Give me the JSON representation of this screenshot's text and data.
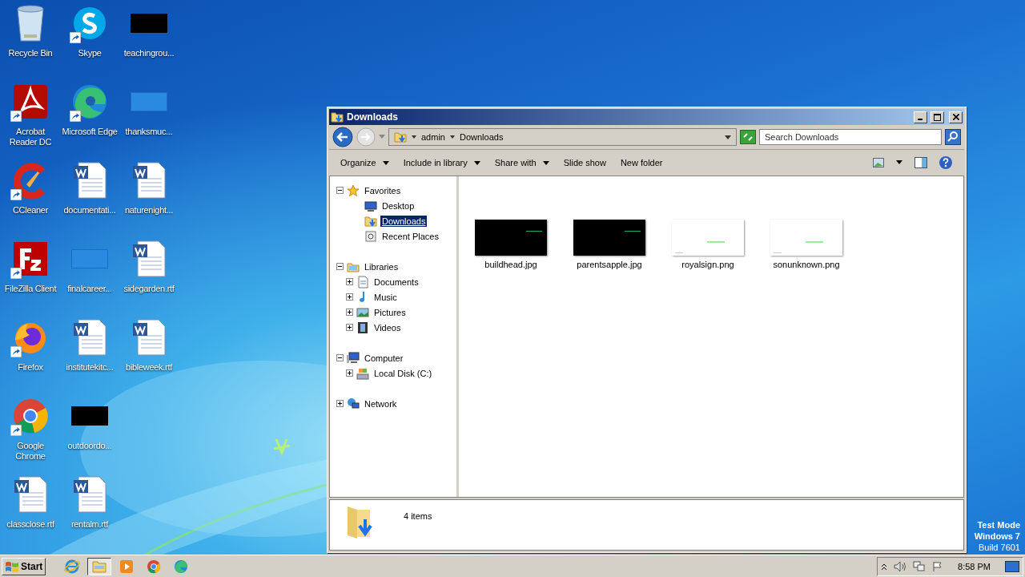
{
  "desktop_icons": [
    {
      "label": "Recycle Bin",
      "kind": "bin",
      "shortcut": false
    },
    {
      "label": "Acrobat Reader DC",
      "kind": "app",
      "shortcut": true
    },
    {
      "label": "CCleaner",
      "kind": "app",
      "shortcut": true
    },
    {
      "label": "FileZilla Client",
      "kind": "app",
      "shortcut": true
    },
    {
      "label": "Firefox",
      "kind": "app",
      "shortcut": true
    },
    {
      "label": "Google Chrome",
      "kind": "app",
      "shortcut": true
    },
    {
      "label": "classclose.rtf",
      "kind": "doc",
      "shortcut": false
    },
    {
      "label": "Skype",
      "kind": "app",
      "shortcut": true
    },
    {
      "label": "Microsoft Edge",
      "kind": "app",
      "shortcut": true
    },
    {
      "label": "documentati...",
      "kind": "doc",
      "shortcut": false
    },
    {
      "label": "finalcareer...",
      "kind": "blank",
      "shortcut": false
    },
    {
      "label": "institutekitc...",
      "kind": "doc",
      "shortcut": false
    },
    {
      "label": "outdoordo...",
      "kind": "dark",
      "shortcut": false
    },
    {
      "label": "rentalm.rtf",
      "kind": "doc",
      "shortcut": false
    },
    {
      "label": "teachingrou...",
      "kind": "dark",
      "shortcut": false
    },
    {
      "label": "thanksmuc...",
      "kind": "blank",
      "shortcut": false
    },
    {
      "label": "naturenight...",
      "kind": "doc",
      "shortcut": false
    },
    {
      "label": "sidegarden.rtf",
      "kind": "doc",
      "shortcut": false
    },
    {
      "label": "bibleweek.rtf",
      "kind": "doc",
      "shortcut": false
    }
  ],
  "window": {
    "title": "Downloads",
    "address": {
      "crumbs": [
        "admin",
        "Downloads"
      ]
    },
    "search": {
      "placeholder": "Search Downloads"
    },
    "toolbar": [
      {
        "label": "Organize",
        "dropdown": true
      },
      {
        "label": "Include in library",
        "dropdown": true
      },
      {
        "label": "Share with",
        "dropdown": true
      },
      {
        "label": "Slide show",
        "dropdown": false
      },
      {
        "label": "New folder",
        "dropdown": false
      }
    ],
    "nav_tree": [
      {
        "label": "Favorites",
        "kind": "star",
        "expanded": true,
        "selected": false,
        "children": [
          {
            "label": "Desktop",
            "kind": "desktop",
            "selected": false
          },
          {
            "label": "Downloads",
            "kind": "downloads",
            "selected": true
          },
          {
            "label": "Recent Places",
            "kind": "recent",
            "selected": false
          }
        ]
      },
      {
        "label": "Libraries",
        "kind": "library",
        "expanded": true,
        "selected": false,
        "children": [
          {
            "label": "Documents",
            "kind": "documents",
            "expanded": false,
            "selected": false
          },
          {
            "label": "Music",
            "kind": "music",
            "expanded": false,
            "selected": false
          },
          {
            "label": "Pictures",
            "kind": "pictures",
            "expanded": false,
            "selected": false
          },
          {
            "label": "Videos",
            "kind": "videos",
            "expanded": false,
            "selected": false
          }
        ]
      },
      {
        "label": "Computer",
        "kind": "computer",
        "expanded": true,
        "selected": false,
        "children": [
          {
            "label": "Local Disk (C:)",
            "kind": "disk",
            "expanded": false,
            "selected": false
          }
        ]
      },
      {
        "label": "Network",
        "kind": "network",
        "expanded": false,
        "selected": false
      }
    ],
    "files": [
      {
        "name": "buildhead.jpg",
        "kind": "dark"
      },
      {
        "name": "parentsapple.jpg",
        "kind": "dark"
      },
      {
        "name": "royalsign.png",
        "kind": "light"
      },
      {
        "name": "sonunknown.png",
        "kind": "light"
      }
    ],
    "status": "4 items"
  },
  "test_mode": {
    "line_1": "Test Mode",
    "line_2": "Windows 7",
    "line_3": "Build 7601"
  },
  "taskbar": {
    "start": "Start",
    "buttons": [
      {
        "kind": "ie",
        "selected": false
      },
      {
        "kind": "explorer",
        "selected": true
      },
      {
        "kind": "media",
        "selected": false
      },
      {
        "kind": "chrome",
        "selected": false
      },
      {
        "kind": "edge",
        "selected": false
      }
    ],
    "clock": "8:58 PM"
  }
}
